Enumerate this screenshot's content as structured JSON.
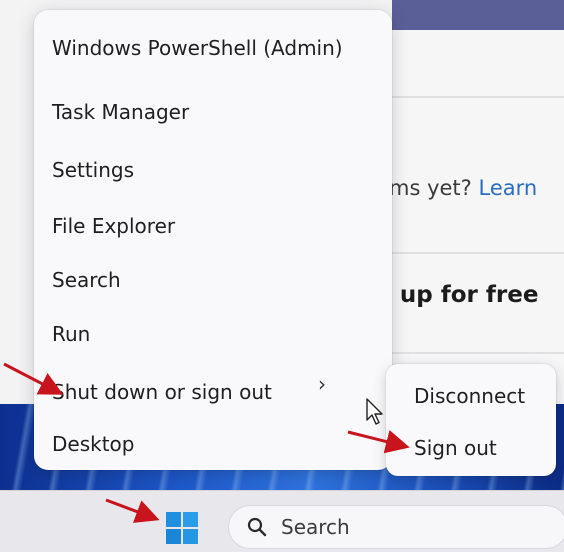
{
  "background": {
    "partial_text_1": "ms yet?",
    "partial_link": "Learn",
    "partial_text_2": "ı up for free"
  },
  "context_menu": {
    "items": [
      {
        "label": "Windows PowerShell (Admin)"
      },
      {
        "label": "Task Manager"
      },
      {
        "label": "Settings"
      },
      {
        "label": "File Explorer"
      },
      {
        "label": "Search"
      },
      {
        "label": "Run"
      },
      {
        "label": "Shut down or sign out"
      },
      {
        "label": "Desktop"
      }
    ],
    "chevron": "›"
  },
  "submenu": {
    "items": [
      {
        "label": "Disconnect"
      },
      {
        "label": "Sign out"
      }
    ]
  },
  "taskbar": {
    "search_label": "Search",
    "start_icon": "windows-logo-icon"
  },
  "colors": {
    "annotation_red": "#c8141c",
    "windows_logo_blue": "#1f8fe0",
    "link_blue": "#2b6cc4"
  }
}
